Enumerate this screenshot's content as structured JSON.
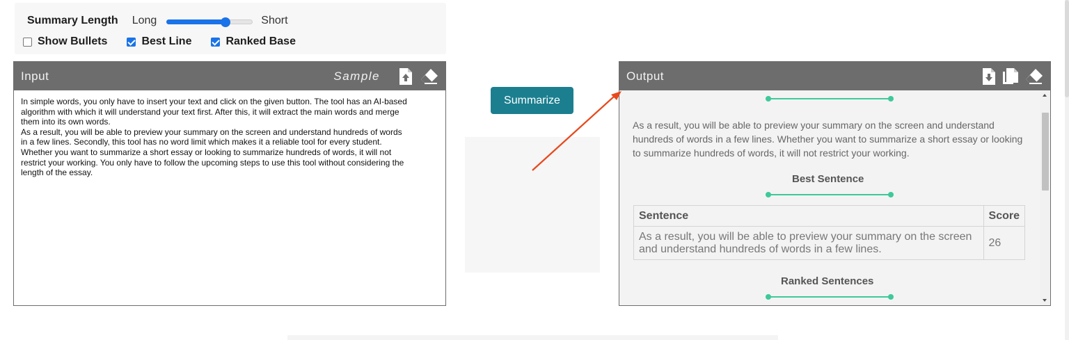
{
  "options": {
    "summary_length_label": "Summary Length",
    "long_label": "Long",
    "short_label": "Short",
    "slider_value_percent": 68,
    "checkboxes": [
      {
        "label": "Show Bullets",
        "checked": false
      },
      {
        "label": "Best Line",
        "checked": true
      },
      {
        "label": "Ranked Base",
        "checked": true
      }
    ]
  },
  "input": {
    "title": "Input",
    "sample_label": "Sample",
    "text": "In simple words, you only have to insert your text and click on the given button. The tool has an AI-based\nalgorithm with which it will understand your text first. After this, it will extract the main words and merge\nthem into its own words.\nAs a result, you will be able to preview your summary on the screen and understand hundreds of words\nin a few lines. Secondly, this tool has no word limit which makes it a reliable tool for every student.\nWhether you want to summarize a short essay or looking to summarize hundreds of words, it will not\nrestrict your working. You only have to follow the upcoming steps to use this tool without considering the\nlength of the essay."
  },
  "summarize_button": "Summarize",
  "output": {
    "title": "Output",
    "summary_text": "As a result, you will be able to preview your summary on the screen and understand hundreds of words in a few lines. Whether you want to summarize a short essay or looking to summarize hundreds of words, it will not restrict your working.",
    "best_sentence_title": "Best Sentence",
    "table": {
      "headers": [
        "Sentence",
        "Score"
      ],
      "rows": [
        {
          "sentence": "As a result, you will be able to preview your summary on the screen and understand hundreds of words in a few lines.",
          "score": "26"
        }
      ]
    },
    "ranked_sentences_title": "Ranked Sentences"
  },
  "colors": {
    "panel_header": "#6d6d6d",
    "button": "#1b7f8f",
    "divider": "#3ec99a",
    "arrow": "#e8491d",
    "checkbox": "#1a73e8"
  }
}
